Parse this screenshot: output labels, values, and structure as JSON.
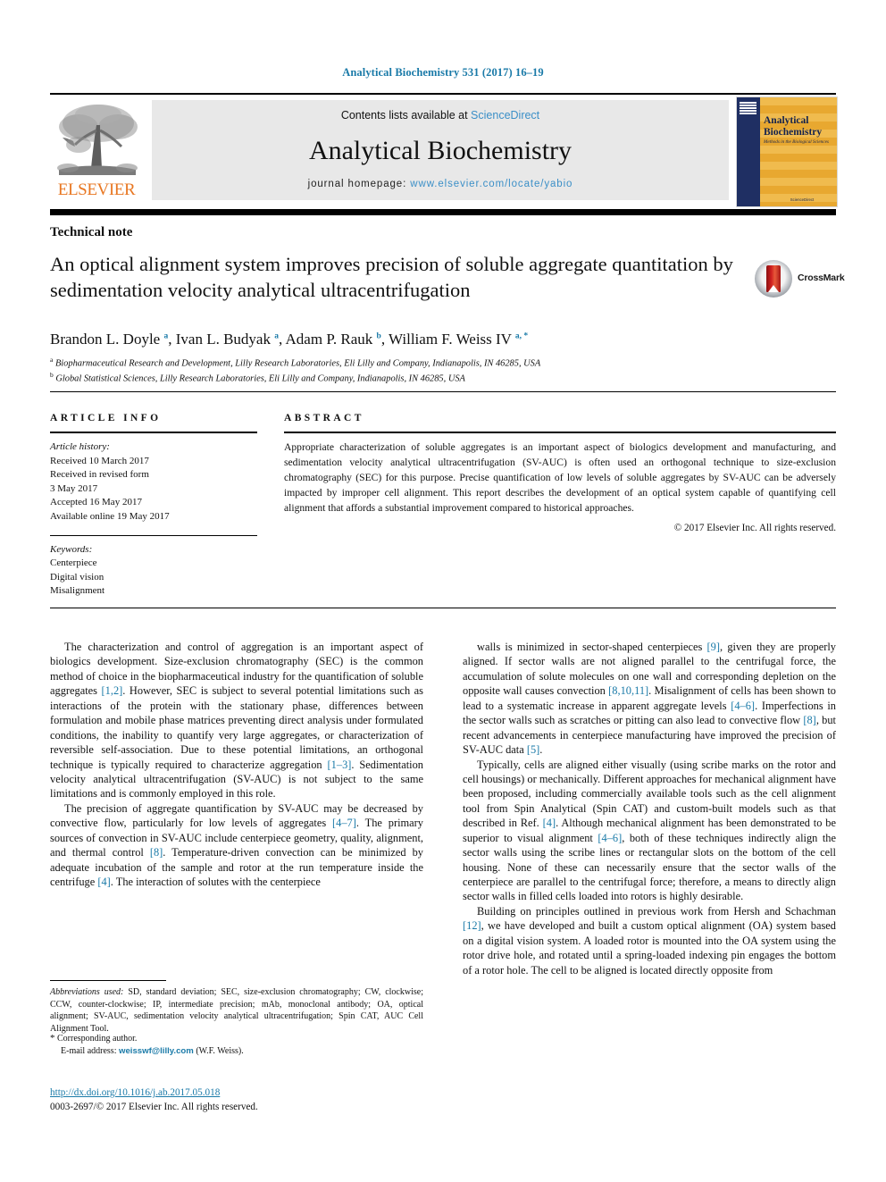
{
  "running_head": "Analytical Biochemistry 531 (2017) 16–19",
  "masthead": {
    "contents_prefix": "Contents lists available at ",
    "sciencedirect": "ScienceDirect",
    "journal_title": "Analytical Biochemistry",
    "homepage_prefix": "journal homepage: ",
    "homepage_url": "www.elsevier.com/locate/yabio",
    "publisher_wordmark": "ELSEVIER",
    "publisher_color": "#e87722",
    "link_color": "#3b8fc7"
  },
  "cover": {
    "title": "Analytical Biochemistry",
    "subtitle": "Methods in the Biological Sciences",
    "footer": "ScienceDirect",
    "band_color": "#1f2f63",
    "stripe_color": "#f0bb4e"
  },
  "article": {
    "kind": "Technical note",
    "title": "An optical alignment system improves precision of soluble aggregate quantitation by sedimentation velocity analytical ultracentrifugation",
    "crossmark_label": "CrossMark",
    "authors_html": "Brandon L. Doyle <sup>a</sup>, Ivan L. Budyak <sup>a</sup>, Adam P. Rauk <sup>b</sup>, William F. Weiss IV <sup>a, *</sup>",
    "affiliations": [
      "Biopharmaceutical Research and Development, Lilly Research Laboratories, Eli Lilly and Company, Indianapolis, IN 46285, USA",
      "Global Statistical Sciences, Lilly Research Laboratories, Eli Lilly and Company, Indianapolis, IN 46285, USA"
    ],
    "affiliation_marks": [
      "a",
      "b"
    ]
  },
  "article_info": {
    "heading": "ARTICLE INFO",
    "history_label": "Article history:",
    "history": [
      "Received 10 March 2017",
      "Received in revised form",
      "3 May 2017",
      "Accepted 16 May 2017",
      "Available online 19 May 2017"
    ],
    "keywords_label": "Keywords:",
    "keywords": [
      "Centerpiece",
      "Digital vision",
      "Misalignment"
    ]
  },
  "abstract": {
    "heading": "ABSTRACT",
    "text": "Appropriate characterization of soluble aggregates is an important aspect of biologics development and manufacturing, and sedimentation velocity analytical ultracentrifugation (SV-AUC) is often used an orthogonal technique to size-exclusion chromatography (SEC) for this purpose. Precise quantification of low levels of soluble aggregates by SV-AUC can be adversely impacted by improper cell alignment. This report describes the development of an optical system capable of quantifying cell alignment that affords a substantial improvement compared to historical approaches.",
    "copyright": "© 2017 Elsevier Inc. All rights reserved."
  },
  "body": {
    "left_paragraphs": [
      "The characterization and control of aggregation is an important aspect of biologics development. Size-exclusion chromatography (SEC) is the common method of choice in the biopharmaceutical industry for the quantification of soluble aggregates [1,2]. However, SEC is subject to several potential limitations such as interactions of the protein with the stationary phase, differences between formulation and mobile phase matrices preventing direct analysis under formulated conditions, the inability to quantify very large aggregates, or characterization of reversible self-association. Due to these potential limitations, an orthogonal technique is typically required to characterize aggregation [1–3]. Sedimentation velocity analytical ultracentrifugation (SV-AUC) is not subject to the same limitations and is commonly employed in this role.",
      "The precision of aggregate quantification by SV-AUC may be decreased by convective flow, particularly for low levels of aggregates [4–7]. The primary sources of convection in SV-AUC include centerpiece geometry, quality, alignment, and thermal control [8]. Temperature-driven convection can be minimized by adequate incubation of the sample and rotor at the run temperature inside the centrifuge [4]. The interaction of solutes with the centerpiece"
    ],
    "right_paragraphs": [
      "walls is minimized in sector-shaped centerpieces [9], given they are properly aligned. If sector walls are not aligned parallel to the centrifugal force, the accumulation of solute molecules on one wall and corresponding depletion on the opposite wall causes convection [8,10,11]. Misalignment of cells has been shown to lead to a systematic increase in apparent aggregate levels [4–6]. Imperfections in the sector walls such as scratches or pitting can also lead to convective flow [8], but recent advancements in centerpiece manufacturing have improved the precision of SV-AUC data [5].",
      "Typically, cells are aligned either visually (using scribe marks on the rotor and cell housings) or mechanically. Different approaches for mechanical alignment have been proposed, including commercially available tools such as the cell alignment tool from Spin Analytical (Spin CAT) and custom-built models such as that described in Ref. [4]. Although mechanical alignment has been demonstrated to be superior to visual alignment [4–6], both of these techniques indirectly align the sector walls using the scribe lines or rectangular slots on the bottom of the cell housing. None of these can necessarily ensure that the sector walls of the centerpiece are parallel to the centrifugal force; therefore, a means to directly align sector walls in filled cells loaded into rotors is highly desirable.",
      "Building on principles outlined in previous work from Hersh and Schachman [12], we have developed and built a custom optical alignment (OA) system based on a digital vision system. A loaded rotor is mounted into the OA system using the rotor drive hole, and rotated until a spring-loaded indexing pin engages the bottom of a rotor hole. The cell to be aligned is located directly opposite from"
    ]
  },
  "footnotes": {
    "abbreviations_label": "Abbreviations used:",
    "abbreviations_text": " SD, standard deviation; SEC, size-exclusion chromatography; CW, clockwise; CCW, counter-clockwise; IP, intermediate precision; mAb, monoclonal antibody; OA, optical alignment; SV-AUC, sedimentation velocity analytical ultracentrifugation; Spin CAT, AUC Cell Alignment Tool.",
    "corresponding": "Corresponding author.",
    "email_label": "E-mail address:",
    "email": "weisswf@lilly.com",
    "email_owner": "(W.F. Weiss).",
    "doi": "http://dx.doi.org/10.1016/j.ab.2017.05.018",
    "issn_line": "0003-2697/© 2017 Elsevier Inc. All rights reserved."
  }
}
